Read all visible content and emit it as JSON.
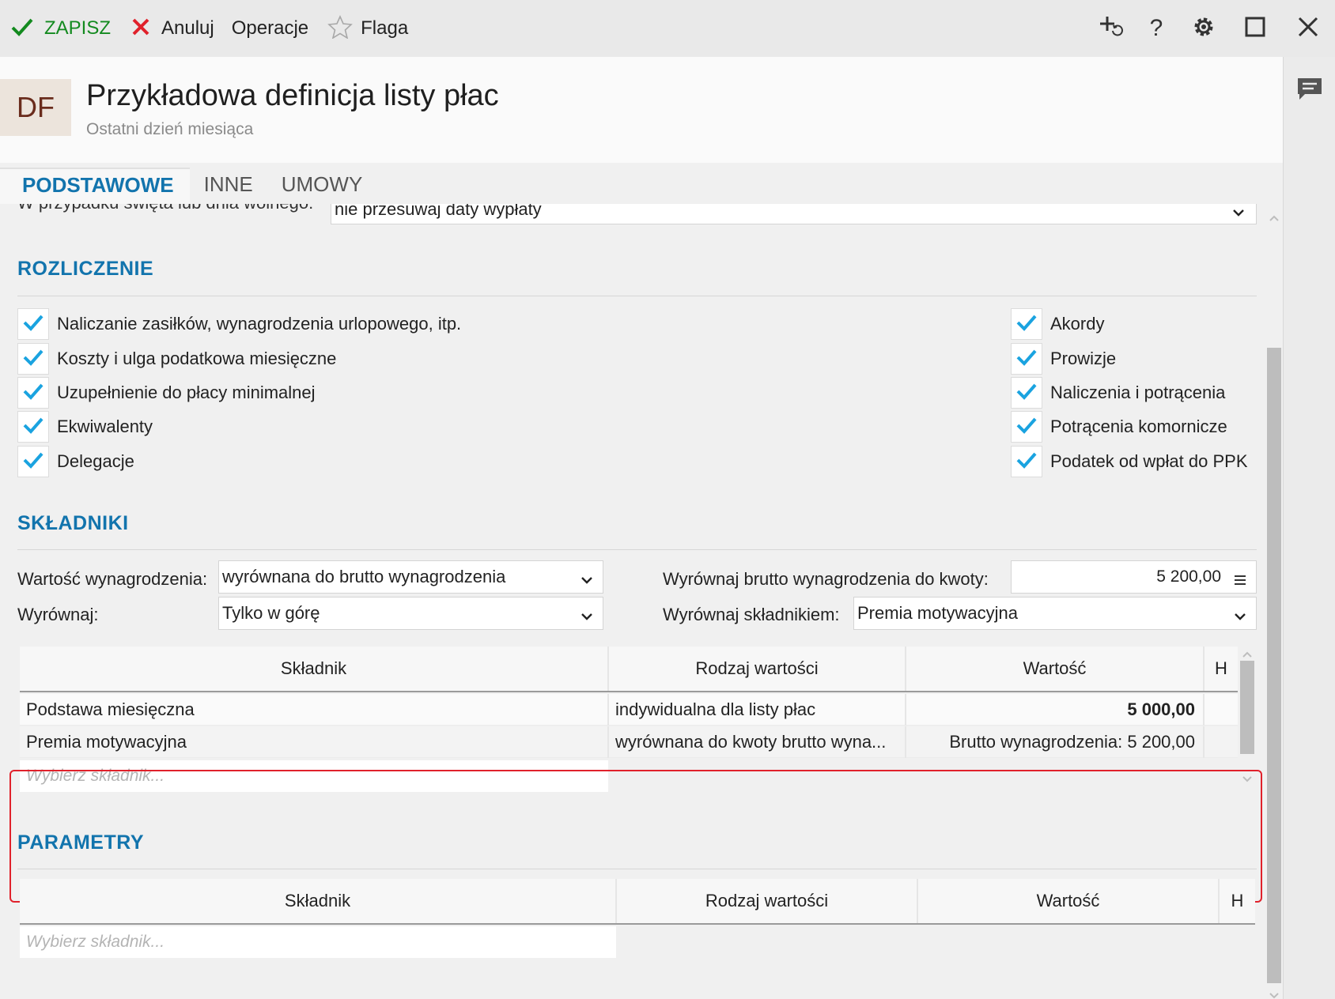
{
  "toolbar": {
    "save_label": "ZAPISZ",
    "cancel_label": "Anuluj",
    "operations_label": "Operacje",
    "flag_label": "Flaga",
    "save_color": "#138a1f",
    "cancel_color": "#e0212b",
    "right_icons": [
      "add-refresh-icon",
      "help-icon",
      "gear-icon",
      "maximize-icon",
      "close-icon"
    ]
  },
  "header": {
    "avatar_initials": "DF",
    "title": "Przykładowa definicja listy płac",
    "subtitle": "Ostatni dzień miesiąca"
  },
  "tabs": [
    {
      "label": "PODSTAWOWE",
      "active": true
    },
    {
      "label": "INNE",
      "active": false
    },
    {
      "label": "UMOWY",
      "active": false
    }
  ],
  "holiday_row": {
    "label": "W przypadku święta lub dnia wolnego:",
    "value": "nie przesuwaj daty wypłaty"
  },
  "rozliczenie": {
    "title": "ROZLICZENIE",
    "left_checks": [
      {
        "label": "Naliczanie zasiłków, wynagrodzenia urlopowego, itp.",
        "checked": true
      },
      {
        "label": "Koszty i ulga podatkowa miesięczne",
        "checked": true
      },
      {
        "label": "Uzupełnienie do płacy minimalnej",
        "checked": true
      },
      {
        "label": "Ekwiwalenty",
        "checked": true
      },
      {
        "label": "Delegacje",
        "checked": true
      }
    ],
    "right_checks": [
      {
        "label": "Akordy",
        "checked": true
      },
      {
        "label": "Prowizje",
        "checked": true
      },
      {
        "label": "Naliczenia i potrącenia",
        "checked": true
      },
      {
        "label": "Potrącenia komornicze",
        "checked": true
      },
      {
        "label": "Podatek od wpłat do PPK",
        "checked": true
      }
    ]
  },
  "skladniki": {
    "title": "SKŁADNIKI",
    "wartosc_label": "Wartość wynagrodzenia:",
    "wartosc_value": "wyrównana do brutto wynagrodzenia",
    "wyrownaj_label": "Wyrównaj:",
    "wyrownaj_value": "Tylko w górę",
    "kwota_label": "Wyrównaj brutto wynagrodzenia do kwoty:",
    "kwota_value": "5 200,00",
    "skladnik_label": "Wyrównaj składnikiem:",
    "skladnik_value": "Premia motywacyjna",
    "columns": [
      "Składnik",
      "Rodzaj wartości",
      "Wartość",
      "H"
    ],
    "rows": [
      {
        "skladnik": "Podstawa miesięczna",
        "rodzaj": "indywidualna dla listy płac",
        "wartosc": "5 000,00",
        "bold": true
      },
      {
        "skladnik": "Premia motywacyjna",
        "rodzaj": "wyrównana do kwoty brutto wyna...",
        "wartosc": "Brutto wynagrodzenia: 5 200,00",
        "bold": false
      }
    ],
    "placeholder": "Wybierz składnik..."
  },
  "parametry": {
    "title": "PARAMETRY",
    "columns": [
      "Składnik",
      "Rodzaj wartości",
      "Wartość",
      "H"
    ],
    "placeholder": "Wybierz składnik...",
    "highlight_color": "#e0212b"
  },
  "colors": {
    "accent": "#1274ad",
    "check": "#1aa3e0"
  }
}
